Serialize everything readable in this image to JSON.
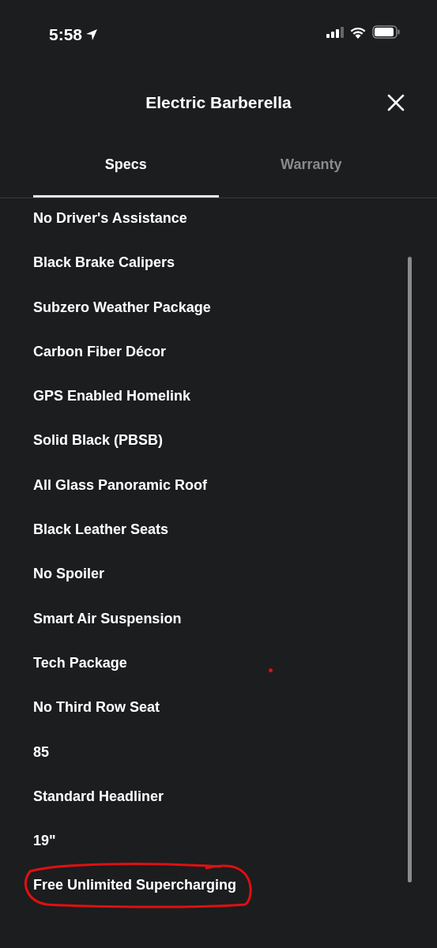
{
  "status_bar": {
    "time": "5:58"
  },
  "header": {
    "title": "Electric Barberella"
  },
  "tabs": [
    {
      "label": "Specs",
      "selected": true
    },
    {
      "label": "Warranty",
      "selected": false
    }
  ],
  "specs": [
    {
      "label": "No Driver's Assistance",
      "circled": false
    },
    {
      "label": "Black Brake Calipers",
      "circled": false
    },
    {
      "label": "Subzero Weather Package",
      "circled": false
    },
    {
      "label": "Carbon Fiber Décor",
      "circled": false
    },
    {
      "label": "GPS Enabled Homelink",
      "circled": false
    },
    {
      "label": "Solid Black (PBSB)",
      "circled": false
    },
    {
      "label": "All Glass Panoramic Roof",
      "circled": false
    },
    {
      "label": "Black Leather Seats",
      "circled": false
    },
    {
      "label": "No Spoiler",
      "circled": false
    },
    {
      "label": "Smart Air Suspension",
      "circled": false
    },
    {
      "label": "Tech Package",
      "circled": false
    },
    {
      "label": "No Third Row Seat",
      "circled": false
    },
    {
      "label": "85",
      "circled": false
    },
    {
      "label": "Standard Headliner",
      "circled": false
    },
    {
      "label": "19\"",
      "circled": false
    },
    {
      "label": "Free Unlimited Supercharging",
      "circled": true
    }
  ]
}
